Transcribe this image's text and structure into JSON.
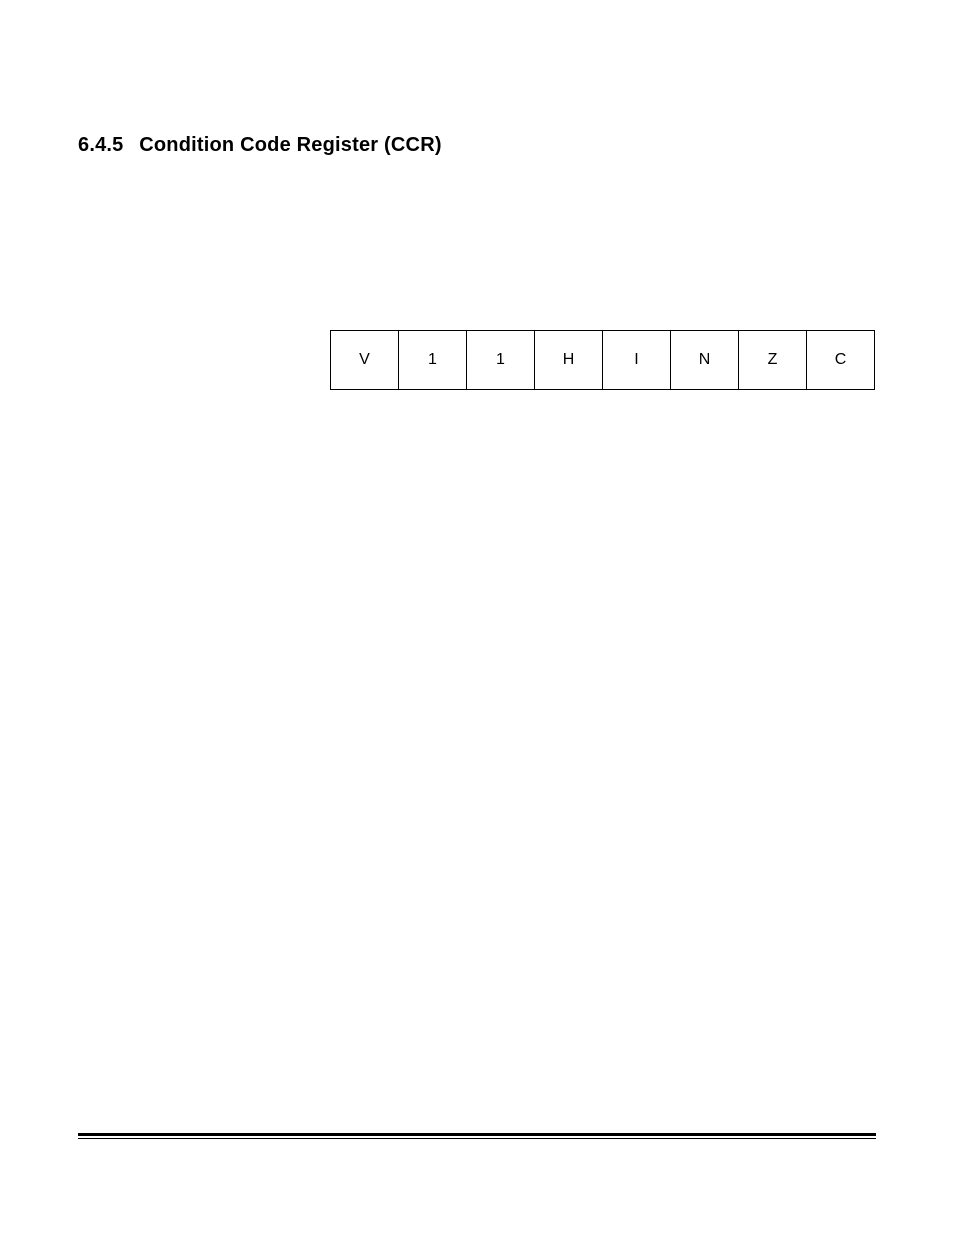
{
  "heading": {
    "number": "6.4.5",
    "title": "Condition Code Register (CCR)"
  },
  "register": {
    "bits": [
      "V",
      "1",
      "1",
      "H",
      "I",
      "N",
      "Z",
      "C"
    ]
  }
}
